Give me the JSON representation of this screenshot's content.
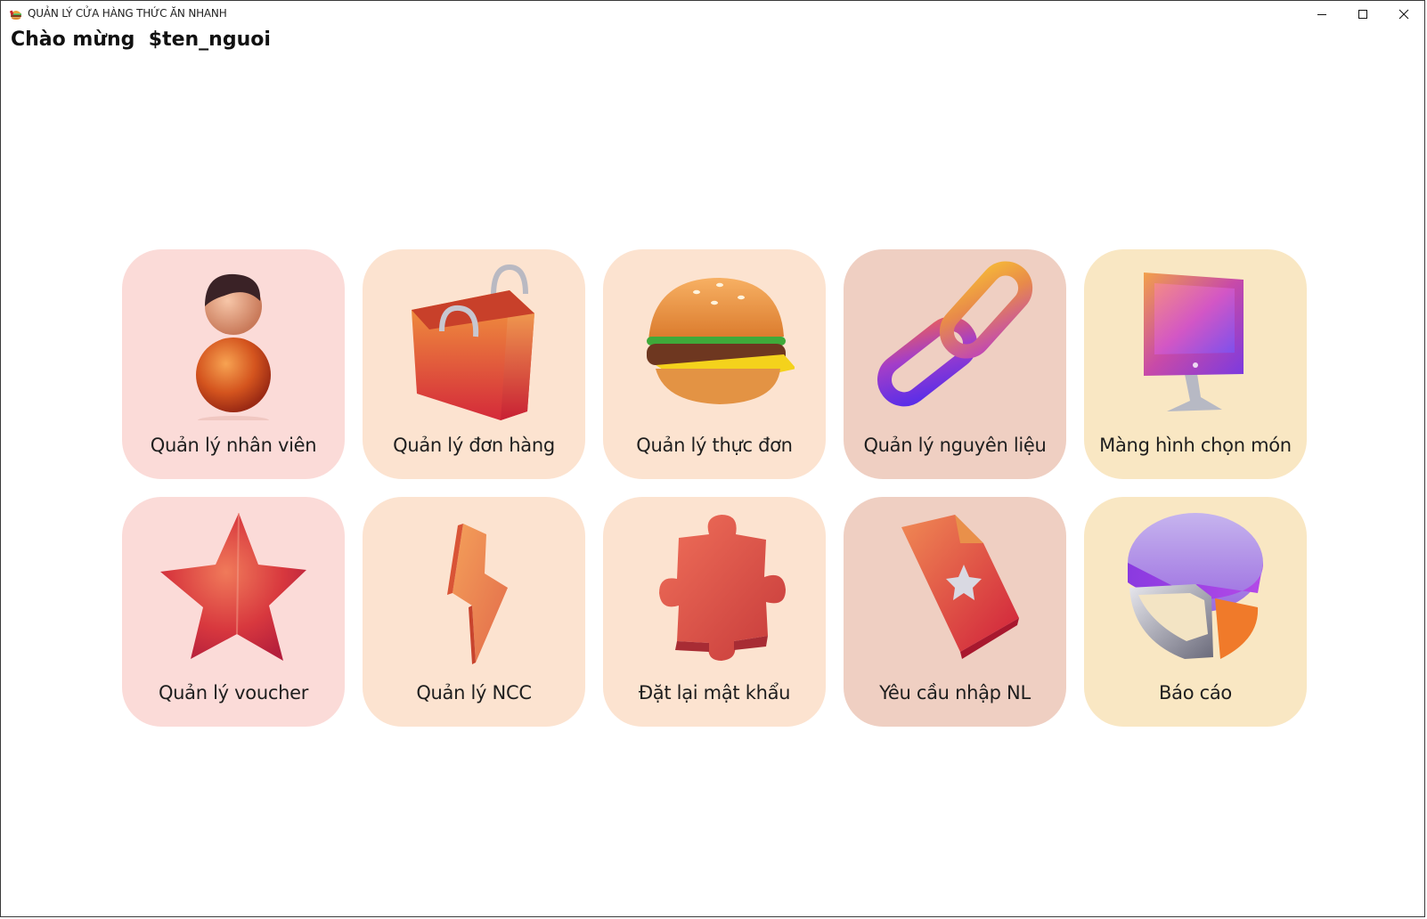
{
  "window": {
    "title": "QUẢN LÝ CỬA HÀNG THỨC ĂN NHANH",
    "controls": {
      "minimize": "—",
      "maximize": "☐",
      "close": "✕"
    }
  },
  "header": {
    "greeting_prefix": "Chào mừng",
    "user_name": "$ten_nguoi"
  },
  "tiles": [
    {
      "label": "Quản lý nhân viên",
      "icon": "person-3d-icon",
      "color": "#fbdbd8"
    },
    {
      "label": "Quản lý đơn hàng",
      "icon": "shopping-bag-3d-icon",
      "color": "#fce3d0"
    },
    {
      "label": "Quản lý thực đơn",
      "icon": "burger-3d-icon",
      "color": "#fce3d0"
    },
    {
      "label": "Quản lý nguyên liệu",
      "icon": "chain-link-3d-icon",
      "color": "#efcfc2"
    },
    {
      "label": "Màng hình chọn món",
      "icon": "monitor-3d-icon",
      "color": "#f9e7c3"
    },
    {
      "label": "Quản lý voucher",
      "icon": "star-3d-icon",
      "color": "#fbdbd8"
    },
    {
      "label": "Quản lý NCC",
      "icon": "lightning-3d-icon",
      "color": "#fce3d0"
    },
    {
      "label": "Đặt lại mật khẩu",
      "icon": "puzzle-piece-3d-icon",
      "color": "#fce3d0"
    },
    {
      "label": "Yêu cầu nhập NL",
      "icon": "document-star-3d-icon",
      "color": "#efcfc2"
    },
    {
      "label": "Báo cáo",
      "icon": "pie-chart-3d-icon",
      "color": "#f9e7c3"
    }
  ]
}
